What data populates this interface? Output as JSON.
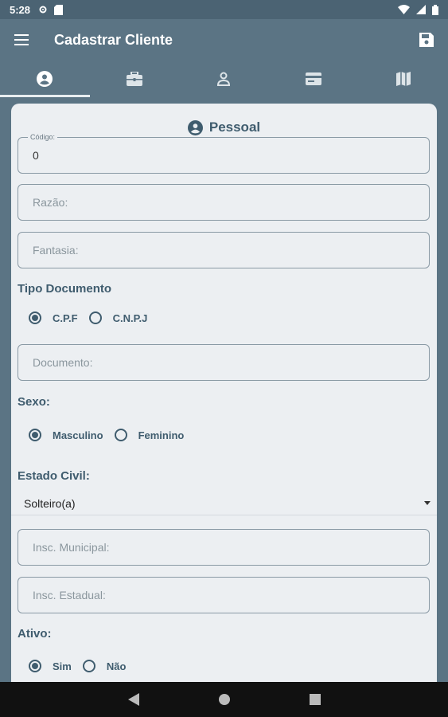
{
  "status": {
    "time": "5:28"
  },
  "app_bar": {
    "title": "Cadastrar Cliente"
  },
  "tabs": [
    {
      "icon": "account-circle-icon",
      "active": true
    },
    {
      "icon": "briefcase-icon",
      "active": false
    },
    {
      "icon": "person-icon",
      "active": false
    },
    {
      "icon": "card-icon",
      "active": false
    },
    {
      "icon": "map-icon",
      "active": false
    }
  ],
  "section": {
    "title": "Pessoal"
  },
  "fields": {
    "codigo": {
      "label": "Código:",
      "value": "0"
    },
    "razao": {
      "placeholder": "Razão:"
    },
    "fantasia": {
      "placeholder": "Fantasia:"
    },
    "documento": {
      "placeholder": "Documento:"
    },
    "insc_municipal": {
      "placeholder": "Insc. Municipal:"
    },
    "insc_estadual": {
      "placeholder": "Insc. Estadual:"
    }
  },
  "tipo_documento": {
    "heading": "Tipo Documento",
    "options": [
      "C.P.F",
      "C.N.P.J"
    ],
    "selected": "C.P.F"
  },
  "sexo": {
    "heading": "Sexo:",
    "options": [
      "Masculino",
      "Feminino"
    ],
    "selected": "Masculino"
  },
  "estado_civil": {
    "heading": "Estado Civil:",
    "selected": "Solteiro(a)"
  },
  "ativo": {
    "heading": "Ativo:",
    "options": [
      "Sim",
      "Não"
    ],
    "selected": "Sim"
  },
  "colors": {
    "primary": "#5b7484",
    "card": "#eceff2",
    "accent_text": "#3f5c6e"
  }
}
